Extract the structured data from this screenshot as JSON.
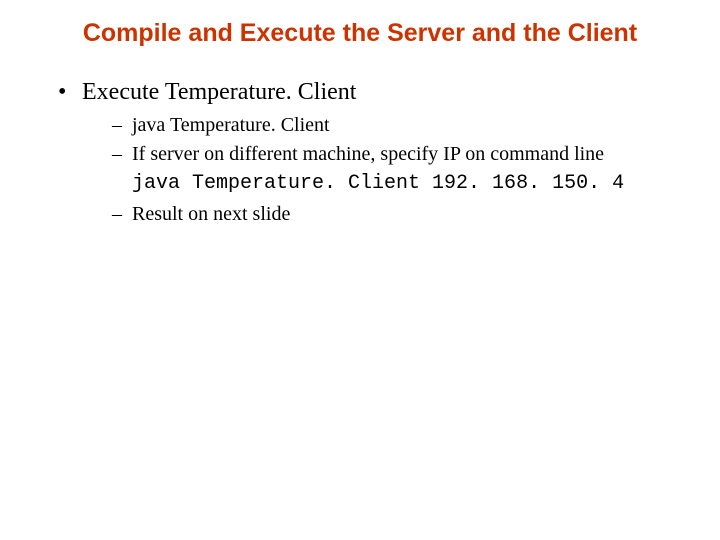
{
  "title": "Compile and Execute the Server and the Client",
  "bullets": {
    "item1": {
      "text": "Execute Temperature. Client",
      "sub": {
        "a": "java Temperature. Client",
        "b": "If server on different machine, specify IP on command line",
        "code": "java Temperature. Client 192. 168. 150. 4",
        "c": "Result on next slide"
      }
    }
  }
}
